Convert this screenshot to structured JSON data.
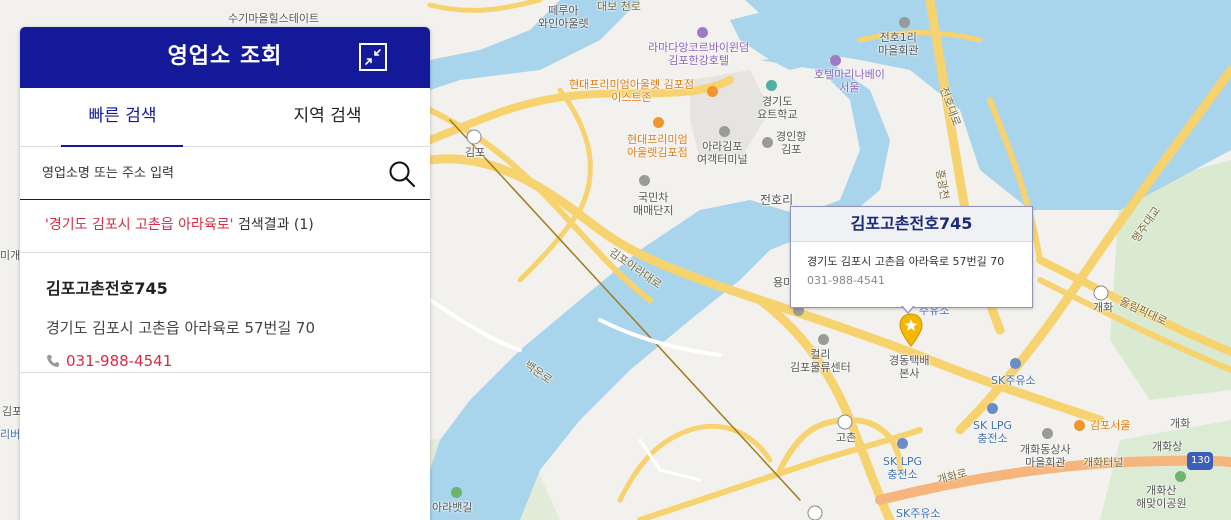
{
  "panel": {
    "title": "영업소 조회",
    "tabs": [
      {
        "label": "빠른 검색",
        "active": true
      },
      {
        "label": "지역 검색",
        "active": false
      }
    ],
    "search": {
      "placeholder": "영업소명 또는 주소 입력",
      "value": ""
    },
    "summary": {
      "query": "'경기도 김포시 고촌읍 아라육로'",
      "suffix": " 검색결과 (1)"
    },
    "results": [
      {
        "name": "김포고촌전호745",
        "address": "경기도 김포시 고촌읍 아라육로 57번길 70",
        "phone": "031-988-4541"
      }
    ]
  },
  "popup": {
    "title": "김포고촌전호745",
    "address": "경기도 김포시 고촌읍 아라육로 57번길 70",
    "phone": "031-988-4541"
  },
  "map": {
    "labels": [
      {
        "id": "l1",
        "text": "수기마을힐스테이트",
        "style": "dark"
      },
      {
        "id": "l2",
        "text": "떼루아\n와인아울렛",
        "style": "dark"
      },
      {
        "id": "l3",
        "text": "대보 천로",
        "style": "road"
      },
      {
        "id": "l4",
        "text": "전호1리\n마을회관",
        "style": "dark"
      },
      {
        "id": "l5",
        "text": "라마다앙코르바이윈덤\n김포한강호텔",
        "style": "purple"
      },
      {
        "id": "l6",
        "text": "호텔마리나베이\n서울",
        "style": "purple"
      },
      {
        "id": "l7",
        "text": "현대프리미엄아울렛 김포점\n이스트존",
        "style": "orange"
      },
      {
        "id": "l8",
        "text": "경기도\n요트학교",
        "style": "dark"
      },
      {
        "id": "l9",
        "text": "경인항\n김포",
        "style": "dark"
      },
      {
        "id": "l10",
        "text": "현대프리미엄\n아울렛김포점",
        "style": "orange"
      },
      {
        "id": "l11",
        "text": "아라김포\n여객터미널",
        "style": "dark"
      },
      {
        "id": "l12",
        "text": "김포",
        "style": "dark"
      },
      {
        "id": "l13",
        "text": "국민차\n매매단지",
        "style": "dark"
      },
      {
        "id": "l14",
        "text": "전호리",
        "style": "dark"
      },
      {
        "id": "l15",
        "text": "김포아라대로",
        "style": "road"
      },
      {
        "id": "l16",
        "text": "용미",
        "style": "dark"
      },
      {
        "id": "l17",
        "text": "컬리\n김포물류센터",
        "style": "dark"
      },
      {
        "id": "l18",
        "text": "경동택배\n본사",
        "style": "dark"
      },
      {
        "id": "l19",
        "text": "SK주유소",
        "style": "blue"
      },
      {
        "id": "l20",
        "text": "SK LPG\n충전소",
        "style": "blue"
      },
      {
        "id": "l21",
        "text": "김포서울",
        "style": "orange"
      },
      {
        "id": "l22",
        "text": "개화동상사\n마을회관",
        "style": "dark"
      },
      {
        "id": "l23",
        "text": "개화터널",
        "style": "road"
      },
      {
        "id": "l24",
        "text": "고촌",
        "style": "dark"
      },
      {
        "id": "l25",
        "text": "SK LPG\n충전소",
        "style": "blue"
      },
      {
        "id": "l26",
        "text": "개화로",
        "style": "road"
      },
      {
        "id": "l27",
        "text": "개화산\n해맞이공원",
        "style": "dark"
      },
      {
        "id": "l28",
        "text": "SK주유소",
        "style": "blue"
      },
      {
        "id": "l29",
        "text": "아라뱃길",
        "style": "dark"
      },
      {
        "id": "l30",
        "text": "백운로",
        "style": "road"
      },
      {
        "id": "l31",
        "text": "전호대로",
        "style": "road"
      },
      {
        "id": "l32",
        "text": "올림픽대로",
        "style": "road"
      },
      {
        "id": "l33",
        "text": "행주대교",
        "style": "road"
      },
      {
        "id": "l34",
        "text": "개화",
        "style": "dark"
      },
      {
        "id": "l35",
        "text": "130",
        "style": "dark"
      },
      {
        "id": "l36",
        "text": "개화",
        "style": "dark"
      },
      {
        "id": "l37",
        "text": "개화상",
        "style": "dark"
      },
      {
        "id": "l38",
        "text": "김포",
        "style": "dark"
      },
      {
        "id": "l39",
        "text": "흥광천",
        "style": "road"
      },
      {
        "id": "l40",
        "text": "주유소",
        "style": "blue"
      },
      {
        "id": "l41",
        "text": "미개솔",
        "style": "dark"
      },
      {
        "id": "l42",
        "text": "리버",
        "style": "dark"
      }
    ]
  },
  "colors": {
    "header": "#14199a",
    "accent": "#d42c45",
    "water": "#a8d4ec",
    "road": "#f7d370",
    "land": "#f2f1ee"
  }
}
